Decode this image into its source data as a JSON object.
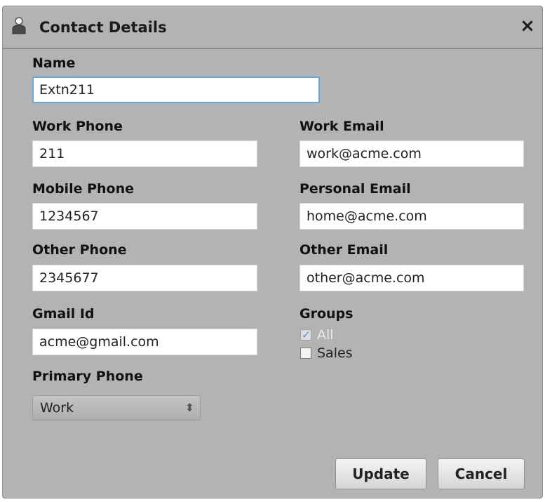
{
  "dialog": {
    "title": "Contact Details",
    "close_label": "×"
  },
  "fields": {
    "name": {
      "label": "Name",
      "value": "Extn211"
    },
    "work_phone": {
      "label": "Work Phone",
      "value": "211"
    },
    "work_email": {
      "label": "Work Email",
      "value": "work@acme.com"
    },
    "mobile_phone": {
      "label": "Mobile Phone",
      "value": "1234567"
    },
    "personal_email": {
      "label": "Personal Email",
      "value": "home@acme.com"
    },
    "other_phone": {
      "label": "Other Phone",
      "value": "2345677"
    },
    "other_email": {
      "label": "Other Email",
      "value": "other@acme.com"
    },
    "gmail_id": {
      "label": "Gmail Id",
      "value": "acme@gmail.com"
    },
    "primary_phone": {
      "label": "Primary Phone",
      "value": "Work"
    }
  },
  "groups": {
    "label": "Groups",
    "items": [
      {
        "label": "All",
        "checked": true,
        "disabled": true
      },
      {
        "label": "Sales",
        "checked": false,
        "disabled": false
      }
    ]
  },
  "buttons": {
    "update": "Update",
    "cancel": "Cancel"
  },
  "icons": {
    "title": "contact-person-icon",
    "close": "close-icon",
    "select_arrows": "up-down-arrows-icon"
  }
}
